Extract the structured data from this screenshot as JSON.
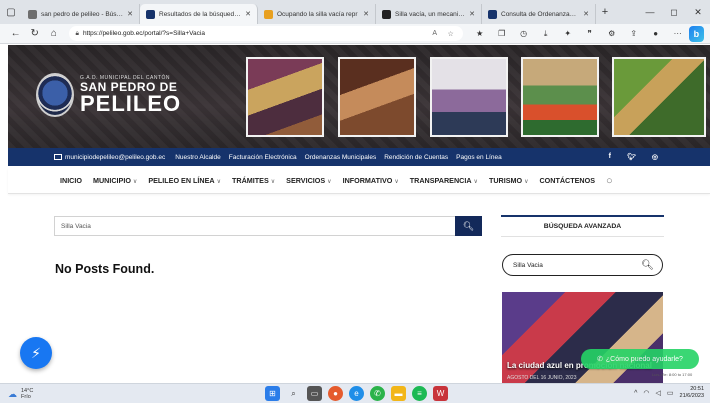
{
  "browser": {
    "tabs": [
      {
        "label": "san pedro de pelileo - Búsqu",
        "icon_color": "#6e6e6e",
        "active": false
      },
      {
        "label": "Resultados de la búsqueda d",
        "icon_color": "#16336b",
        "active": true
      },
      {
        "label": "Ocupando la silla vacía repr",
        "icon_color": "#e8a020",
        "active": false
      },
      {
        "label": "Silla vacía, un mecanismo de",
        "icon_color": "#222222",
        "active": false
      },
      {
        "label": "Consulta de Ordenanzas GAD",
        "icon_color": "#16336b",
        "active": false
      }
    ],
    "url": "https://pelileo.gob.ec/portal/?s=Silla+Vacia"
  },
  "site": {
    "logo_small": "G.A.D. MUNICIPAL DEL CANTÓN",
    "logo_mid": "SAN PEDRO DE",
    "logo_big": "PELILEO",
    "topbar": {
      "email": "municipiodepelileo@pelileo.gob.ec",
      "links": [
        "Nuestro Alcalde",
        "Facturación Electrónica",
        "Ordenanzas Municipales",
        "Rendición de Cuentas",
        "Pagos en Línea"
      ],
      "social": [
        "f",
        "t",
        "i"
      ]
    },
    "menu": [
      {
        "label": "INICIO",
        "dropdown": false
      },
      {
        "label": "MUNICIPIO",
        "dropdown": true
      },
      {
        "label": "PELILEO EN LÍNEA",
        "dropdown": true
      },
      {
        "label": "TRÁMITES",
        "dropdown": true
      },
      {
        "label": "SERVICIOS",
        "dropdown": true
      },
      {
        "label": "INFORMATIVO",
        "dropdown": true
      },
      {
        "label": "TRANSPARENCIA",
        "dropdown": true
      },
      {
        "label": "TURISMO",
        "dropdown": true
      },
      {
        "label": "CONTÁCTENOS",
        "dropdown": false
      }
    ]
  },
  "content": {
    "search_value": "Silla Vacia",
    "no_results": "No Posts Found."
  },
  "sidebar": {
    "title": "BÚSQUEDA AVANZADA",
    "search_value": "Silla Vacia",
    "featured_caption": "La ciudad azul en promoción nacional",
    "featured_date": "AGOSTO DEL 16 JUNIO, 2023"
  },
  "widgets": {
    "whatsapp_label": "¿Cómo puedo ayudarle?",
    "whatsapp_hours": "Lun–Vie: 8:00 to 17:00"
  },
  "taskbar": {
    "temperature": "14°C",
    "weather": "Frío",
    "time": "20:51",
    "date": "21/6/2023"
  }
}
